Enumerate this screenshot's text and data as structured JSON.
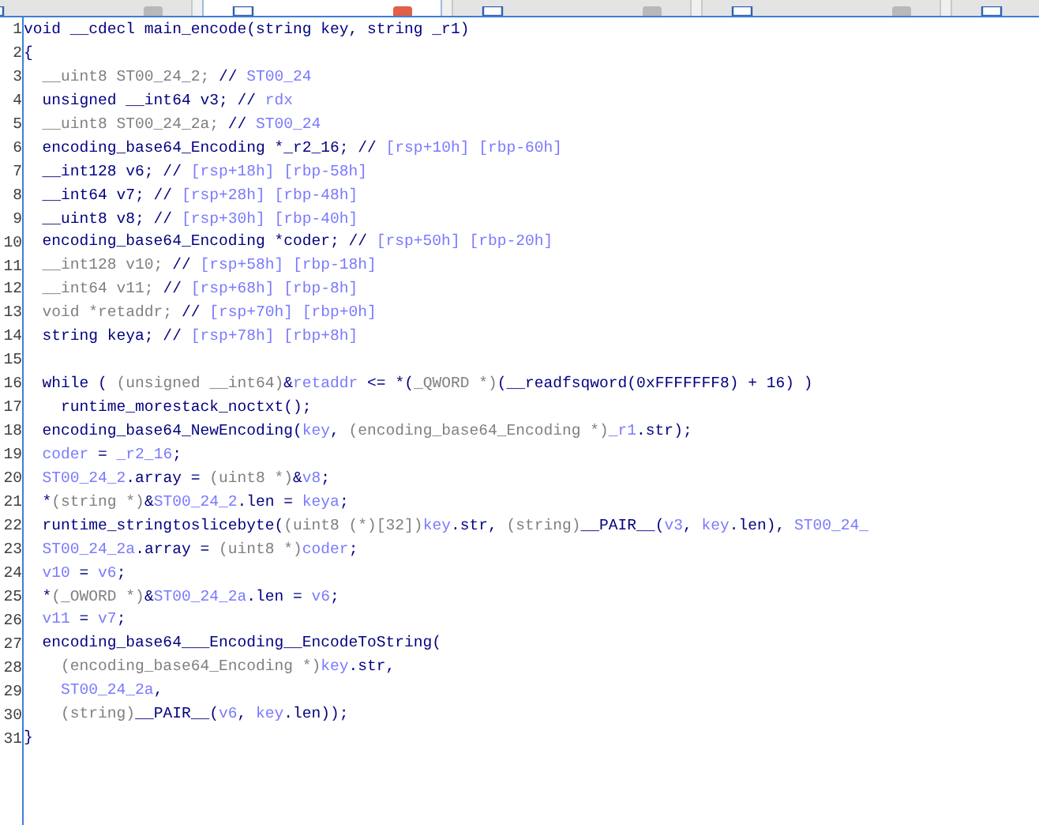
{
  "tabs": [
    {
      "selected": false
    },
    {
      "selected": true
    },
    {
      "selected": false
    },
    {
      "selected": false
    },
    {
      "selected": false
    }
  ],
  "lines": [
    {
      "number": "1",
      "tokens": [
        {
          "kind": "code",
          "text": "void __cdecl main_encode(string key, string _r1)"
        }
      ]
    },
    {
      "number": "2",
      "tokens": [
        {
          "kind": "code",
          "text": "{"
        }
      ]
    },
    {
      "number": "3",
      "tokens": [
        {
          "kind": "dim",
          "text": "  __uint8 ST00_24_2; "
        },
        {
          "kind": "code",
          "text": "// "
        },
        {
          "kind": "var",
          "text": "ST00_24"
        }
      ]
    },
    {
      "number": "4",
      "tokens": [
        {
          "kind": "code",
          "text": "  unsigned __int64 v3; // "
        },
        {
          "kind": "var",
          "text": "rdx"
        }
      ]
    },
    {
      "number": "5",
      "tokens": [
        {
          "kind": "dim",
          "text": "  __uint8 ST00_24_2a; "
        },
        {
          "kind": "code",
          "text": "// "
        },
        {
          "kind": "var",
          "text": "ST00_24"
        }
      ]
    },
    {
      "number": "6",
      "tokens": [
        {
          "kind": "code",
          "text": "  encoding_base64_Encoding *_r2_16; // "
        },
        {
          "kind": "var",
          "text": "[rsp+10h] [rbp-60h]"
        }
      ]
    },
    {
      "number": "7",
      "tokens": [
        {
          "kind": "code",
          "text": "  __int128 v6; // "
        },
        {
          "kind": "var",
          "text": "[rsp+18h] [rbp-58h]"
        }
      ]
    },
    {
      "number": "8",
      "tokens": [
        {
          "kind": "code",
          "text": "  __int64 v7; // "
        },
        {
          "kind": "var",
          "text": "[rsp+28h] [rbp-48h]"
        }
      ]
    },
    {
      "number": "9",
      "tokens": [
        {
          "kind": "code",
          "text": "  __uint8 v8; // "
        },
        {
          "kind": "var",
          "text": "[rsp+30h] [rbp-40h]"
        }
      ]
    },
    {
      "number": "10",
      "tokens": [
        {
          "kind": "code",
          "text": "  encoding_base64_Encoding *coder; // "
        },
        {
          "kind": "var",
          "text": "[rsp+50h] [rbp-20h]"
        }
      ]
    },
    {
      "number": "11",
      "tokens": [
        {
          "kind": "dim",
          "text": "  __int128 v10; "
        },
        {
          "kind": "code",
          "text": "// "
        },
        {
          "kind": "var",
          "text": "[rsp+58h] [rbp-18h]"
        }
      ]
    },
    {
      "number": "12",
      "tokens": [
        {
          "kind": "dim",
          "text": "  __int64 v11; "
        },
        {
          "kind": "code",
          "text": "// "
        },
        {
          "kind": "var",
          "text": "[rsp+68h] [rbp-8h]"
        }
      ]
    },
    {
      "number": "13",
      "tokens": [
        {
          "kind": "dim",
          "text": "  void *retaddr; "
        },
        {
          "kind": "code",
          "text": "// "
        },
        {
          "kind": "var",
          "text": "[rsp+70h] [rbp+0h]"
        }
      ]
    },
    {
      "number": "14",
      "tokens": [
        {
          "kind": "code",
          "text": "  string keya; // "
        },
        {
          "kind": "var",
          "text": "[rsp+78h] [rbp+8h]"
        }
      ]
    },
    {
      "number": "15"
    },
    {
      "number": "16",
      "tokens": [
        {
          "kind": "code",
          "text": "  while ( "
        },
        {
          "kind": "dim",
          "text": "(unsigned __int64)"
        },
        {
          "kind": "code",
          "text": "&"
        },
        {
          "kind": "var",
          "text": "retaddr"
        },
        {
          "kind": "code",
          "text": " <= *("
        },
        {
          "kind": "dim",
          "text": "_QWORD *)"
        },
        {
          "kind": "code",
          "text": "(__readfsqword(0xFFFFFFF8) + 16) )"
        }
      ]
    },
    {
      "number": "17",
      "tokens": [
        {
          "kind": "code",
          "text": "    runtime_morestack_noctxt();"
        }
      ]
    },
    {
      "number": "18",
      "tokens": [
        {
          "kind": "code",
          "text": "  encoding_base64_NewEncoding("
        },
        {
          "kind": "var",
          "text": "key"
        },
        {
          "kind": "code",
          "text": ", "
        },
        {
          "kind": "dim",
          "text": "(encoding_base64_Encoding *)"
        },
        {
          "kind": "var",
          "text": "_r1"
        },
        {
          "kind": "code",
          "text": ".str);"
        }
      ]
    },
    {
      "number": "19",
      "tokens": [
        {
          "kind": "var",
          "text": "  coder"
        },
        {
          "kind": "code",
          "text": " = "
        },
        {
          "kind": "var",
          "text": "_r2_16"
        },
        {
          "kind": "code",
          "text": ";"
        }
      ]
    },
    {
      "number": "20",
      "tokens": [
        {
          "kind": "var",
          "text": "  ST00_24_2"
        },
        {
          "kind": "code",
          "text": ".array = "
        },
        {
          "kind": "dim",
          "text": "(uint8 *)"
        },
        {
          "kind": "code",
          "text": "&"
        },
        {
          "kind": "var",
          "text": "v8"
        },
        {
          "kind": "code",
          "text": ";"
        }
      ]
    },
    {
      "number": "21",
      "tokens": [
        {
          "kind": "code",
          "text": "  *"
        },
        {
          "kind": "dim",
          "text": "(string *)"
        },
        {
          "kind": "code",
          "text": "&"
        },
        {
          "kind": "var",
          "text": "ST00_24_2"
        },
        {
          "kind": "code",
          "text": ".len = "
        },
        {
          "kind": "var",
          "text": "keya"
        },
        {
          "kind": "code",
          "text": ";"
        }
      ]
    },
    {
      "number": "22",
      "tokens": [
        {
          "kind": "code",
          "text": "  runtime_stringtoslicebyte("
        },
        {
          "kind": "dim",
          "text": "(uint8 (*)[32])"
        },
        {
          "kind": "var",
          "text": "key"
        },
        {
          "kind": "code",
          "text": ".str, "
        },
        {
          "kind": "dim",
          "text": "(string)"
        },
        {
          "kind": "code",
          "text": "__PAIR__("
        },
        {
          "kind": "var",
          "text": "v3"
        },
        {
          "kind": "code",
          "text": ", "
        },
        {
          "kind": "var",
          "text": "key"
        },
        {
          "kind": "code",
          "text": ".len), "
        },
        {
          "kind": "var",
          "text": "ST00_24_"
        }
      ]
    },
    {
      "number": "23",
      "tokens": [
        {
          "kind": "var",
          "text": "  ST00_24_2a"
        },
        {
          "kind": "code",
          "text": ".array = "
        },
        {
          "kind": "dim",
          "text": "(uint8 *)"
        },
        {
          "kind": "var",
          "text": "coder"
        },
        {
          "kind": "code",
          "text": ";"
        }
      ]
    },
    {
      "number": "24",
      "tokens": [
        {
          "kind": "var",
          "text": "  v10"
        },
        {
          "kind": "code",
          "text": " = "
        },
        {
          "kind": "var",
          "text": "v6"
        },
        {
          "kind": "code",
          "text": ";"
        }
      ]
    },
    {
      "number": "25",
      "tokens": [
        {
          "kind": "code",
          "text": "  *"
        },
        {
          "kind": "dim",
          "text": "(_OWORD *)"
        },
        {
          "kind": "code",
          "text": "&"
        },
        {
          "kind": "var",
          "text": "ST00_24_2a"
        },
        {
          "kind": "code",
          "text": ".len = "
        },
        {
          "kind": "var",
          "text": "v6"
        },
        {
          "kind": "code",
          "text": ";"
        }
      ]
    },
    {
      "number": "26",
      "tokens": [
        {
          "kind": "var",
          "text": "  v11"
        },
        {
          "kind": "code",
          "text": " = "
        },
        {
          "kind": "var",
          "text": "v7"
        },
        {
          "kind": "code",
          "text": ";"
        }
      ]
    },
    {
      "number": "27",
      "tokens": [
        {
          "kind": "code",
          "text": "  encoding_base64___Encoding__EncodeToString("
        }
      ]
    },
    {
      "number": "28",
      "tokens": [
        {
          "kind": "dim",
          "text": "    (encoding_base64_Encoding *)"
        },
        {
          "kind": "var",
          "text": "key"
        },
        {
          "kind": "code",
          "text": ".str,"
        }
      ]
    },
    {
      "number": "29",
      "tokens": [
        {
          "kind": "var",
          "text": "    ST00_24_2a"
        },
        {
          "kind": "code",
          "text": ","
        }
      ]
    },
    {
      "number": "30",
      "tokens": [
        {
          "kind": "dim",
          "text": "    (string)"
        },
        {
          "kind": "code",
          "text": "__PAIR__("
        },
        {
          "kind": "var",
          "text": "v6"
        },
        {
          "kind": "code",
          "text": ", "
        },
        {
          "kind": "var",
          "text": "key"
        },
        {
          "kind": "code",
          "text": ".len));"
        }
      ]
    },
    {
      "number": "31",
      "tokens": [
        {
          "kind": "code",
          "text": "}"
        }
      ]
    }
  ]
}
